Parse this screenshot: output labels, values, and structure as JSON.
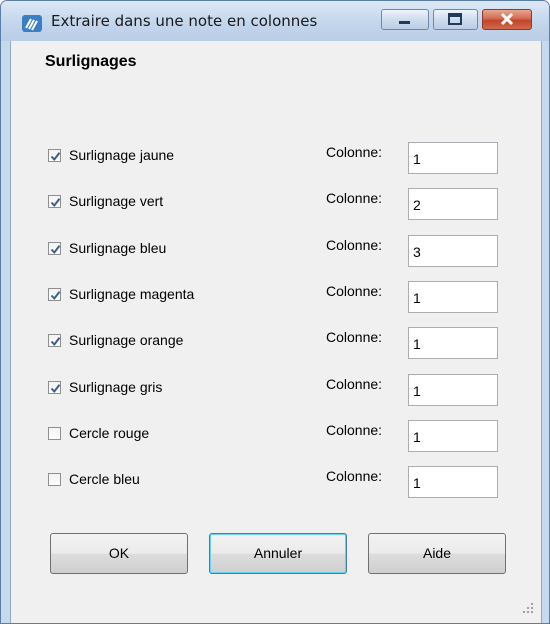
{
  "window": {
    "title": "Extraire dans une note en colonnes"
  },
  "section": {
    "title": "Surlignages"
  },
  "column_label": "Colonne:",
  "rows": [
    {
      "label": "Surlignage jaune",
      "checked": true,
      "column": "1"
    },
    {
      "label": "Surlignage vert",
      "checked": true,
      "column": "2"
    },
    {
      "label": "Surlignage bleu",
      "checked": true,
      "column": "3"
    },
    {
      "label": "Surlignage magenta",
      "checked": true,
      "column": "1"
    },
    {
      "label": "Surlignage orange",
      "checked": true,
      "column": "1"
    },
    {
      "label": "Surlignage gris",
      "checked": true,
      "column": "1"
    },
    {
      "label": "Cercle rouge",
      "checked": false,
      "column": "1"
    },
    {
      "label": "Cercle bleu",
      "checked": false,
      "column": "1"
    }
  ],
  "buttons": {
    "ok": "OK",
    "cancel": "Annuler",
    "help": "Aide"
  }
}
